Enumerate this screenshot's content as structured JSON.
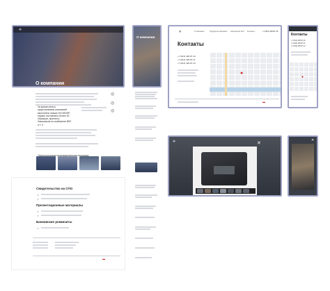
{
  "colors": {
    "frame_border": "#9ea2c4",
    "accent_red": "#d42c2c",
    "nav_dark": "#2b2f36",
    "map_bg": "#eaecef",
    "modal_overlay": "#383c45"
  },
  "main": {
    "hero_title": "О компании",
    "intro_heading": "За время своего существования компанией выполнено свыше 60 НИОКР, первое поставлено более 30 образцов, принятых Заказчиком на снабжение ВВТ и т. п.",
    "section_heading": "Технологическая производственная площадка компании предоставляет собой производственные, офисные и вспомогательные помещения с полной инфраструктурой"
  },
  "mobile_about": {
    "hero_title": "О компании"
  },
  "contacts_page": {
    "title": "Контакты",
    "phone_1": "+7 (812) 325-87-10",
    "phone_2": "+7 (812) 325-87-11",
    "phone_3": "+7 (812) 325-87-13",
    "phone_4": "+7 (812) 325-87-14",
    "nav_items": [
      "О компании",
      "Продукция компании",
      "Автоматика АСУ",
      "Контакты"
    ],
    "footer_phone": "+7 (812) 325-87-10"
  },
  "mobile_contacts": {
    "title": "Контакты"
  },
  "docs_page": {
    "section_1": "Свидетельство на СПО",
    "section_2": "Презентационные материалы",
    "section_3": "Банковские реквизиты"
  }
}
